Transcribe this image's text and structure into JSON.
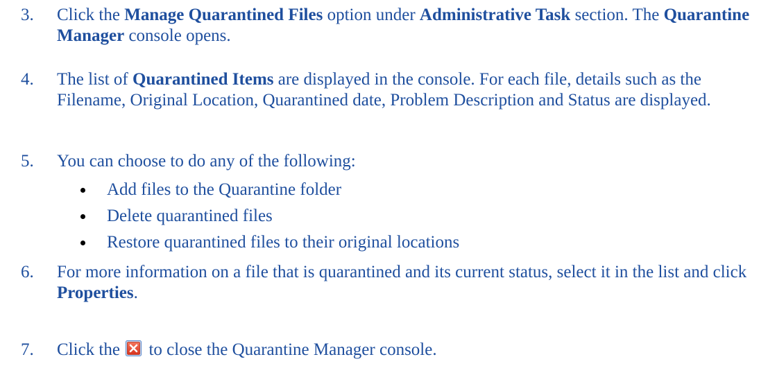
{
  "steps": [
    {
      "number": "3.",
      "parts": [
        {
          "text": "Click the ",
          "bold": false
        },
        {
          "text": "Manage Quarantined Files",
          "bold": true
        },
        {
          "text": " option under ",
          "bold": false
        },
        {
          "text": "Administrative Task",
          "bold": true
        },
        {
          "text": " section. The ",
          "bold": false
        },
        {
          "text": "Quarantine Manager",
          "bold": true
        },
        {
          "text": " console opens.",
          "bold": false
        }
      ]
    },
    {
      "number": "4.",
      "parts": [
        {
          "text": "The list of ",
          "bold": false
        },
        {
          "text": "Quarantined Items",
          "bold": true
        },
        {
          "text": " are displayed in the console.  For each file, details such as the Filename, Original Location, Quarantined date, Problem Description and Status are displayed.",
          "bold": false
        }
      ]
    },
    {
      "number": "5.",
      "parts": [
        {
          "text": "You can choose to do any of the following:",
          "bold": false
        }
      ],
      "bullets": [
        "Add files to the Quarantine folder",
        "Delete quarantined files",
        "Restore quarantined files to their original locations"
      ]
    },
    {
      "number": "6.",
      "parts": [
        {
          "text": "For more information on a file that is quarantined and its current status, select it in the list and click ",
          "bold": false
        },
        {
          "text": "Properties",
          "bold": true
        },
        {
          "text": ".",
          "bold": false
        }
      ]
    },
    {
      "number": "7.",
      "before_icon": "Click the",
      "icon": "close-icon",
      "after_icon": " to close the Quarantine Manager console."
    }
  ],
  "colors": {
    "text": "#1f4f9e",
    "bullet": "#000000",
    "close_icon_bg": "#e8402a",
    "close_icon_border": "#5a86c8"
  }
}
